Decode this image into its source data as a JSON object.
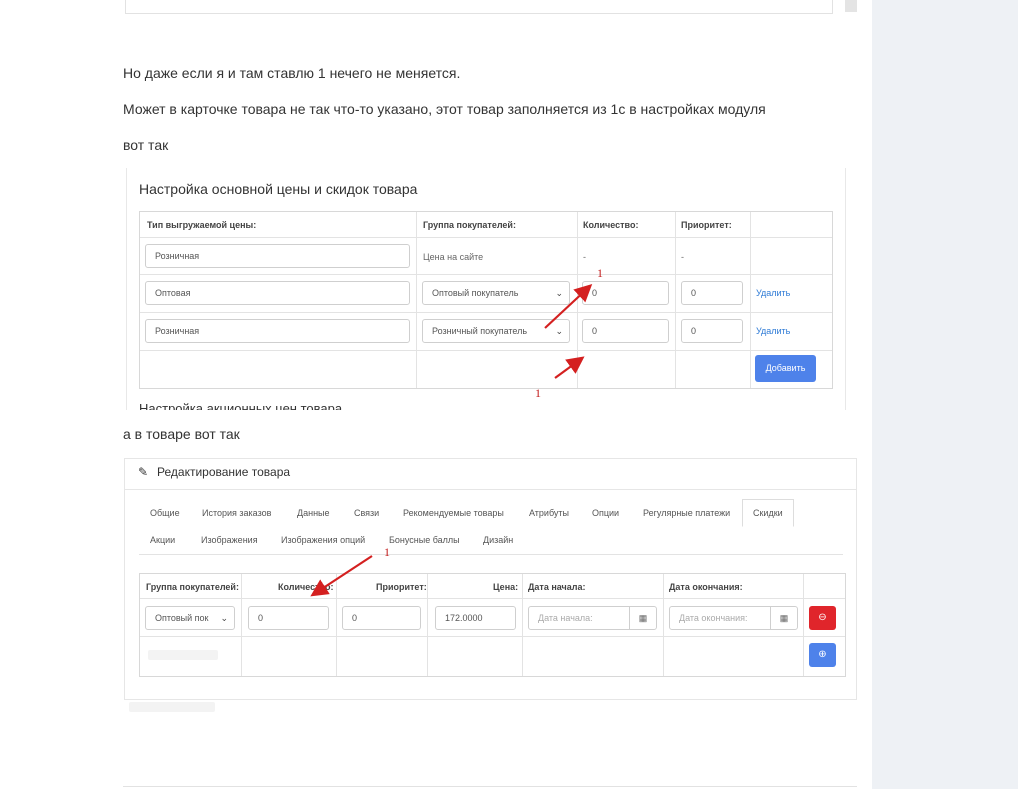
{
  "post": {
    "p1": "Но даже если я и там ставлю 1 нечего не меняется.",
    "p2": "Может в карточке товара не так что-то указано, этот товар заполняется из 1с в настройках модуля",
    "p3": "вот так",
    "p4": "а в товаре вот так"
  },
  "shot1": {
    "title": "Настройка основной цены и скидок товара",
    "headers": [
      "Тип выгружаемой цены:",
      "Группа покупателей:",
      "Количество:",
      "Приоритет:"
    ],
    "rows": [
      {
        "price_type": "Розничная",
        "group": "Цена на сайте",
        "qty": "-",
        "priority": "-"
      },
      {
        "price_type": "Оптовая",
        "group": "Оптовый покупатель",
        "qty": "0",
        "priority": "0",
        "action": "Удалить"
      },
      {
        "price_type": "Розничная",
        "group": "Розничный покупатель",
        "qty": "0",
        "priority": "0",
        "action": "Удалить"
      }
    ],
    "add_button": "Добавить",
    "cut_off_heading": "Настройка акционных цен товара",
    "annotation_top": "1",
    "annotation_bottom": "1"
  },
  "shot2": {
    "title": "Редактирование товара",
    "tabs_row1": [
      "Общие",
      "История заказов",
      "Данные",
      "Связи",
      "Рекомендуемые товары",
      "Атрибуты",
      "Опции",
      "Регулярные платежи",
      "Скидки"
    ],
    "tabs_row2": [
      "Акции",
      "Изображения",
      "Изображения опций",
      "Бонусные баллы",
      "Дизайн"
    ],
    "active_tab": "Скидки",
    "headers": [
      "Группа покупателей:",
      "Количество:",
      "Приоритет:",
      "Цена:",
      "Дата начала:",
      "Дата окончания:"
    ],
    "row": {
      "group": "Оптовый пок",
      "qty": "0",
      "priority": "0",
      "price": "172.0000",
      "date_start_placeholder": "Дата начала:",
      "date_end_placeholder": "Дата окончания:"
    },
    "annotation": "1"
  },
  "colors": {
    "accent_blue": "#4e82ea",
    "danger_red": "#e0252b",
    "annotation_red": "#d42020"
  }
}
